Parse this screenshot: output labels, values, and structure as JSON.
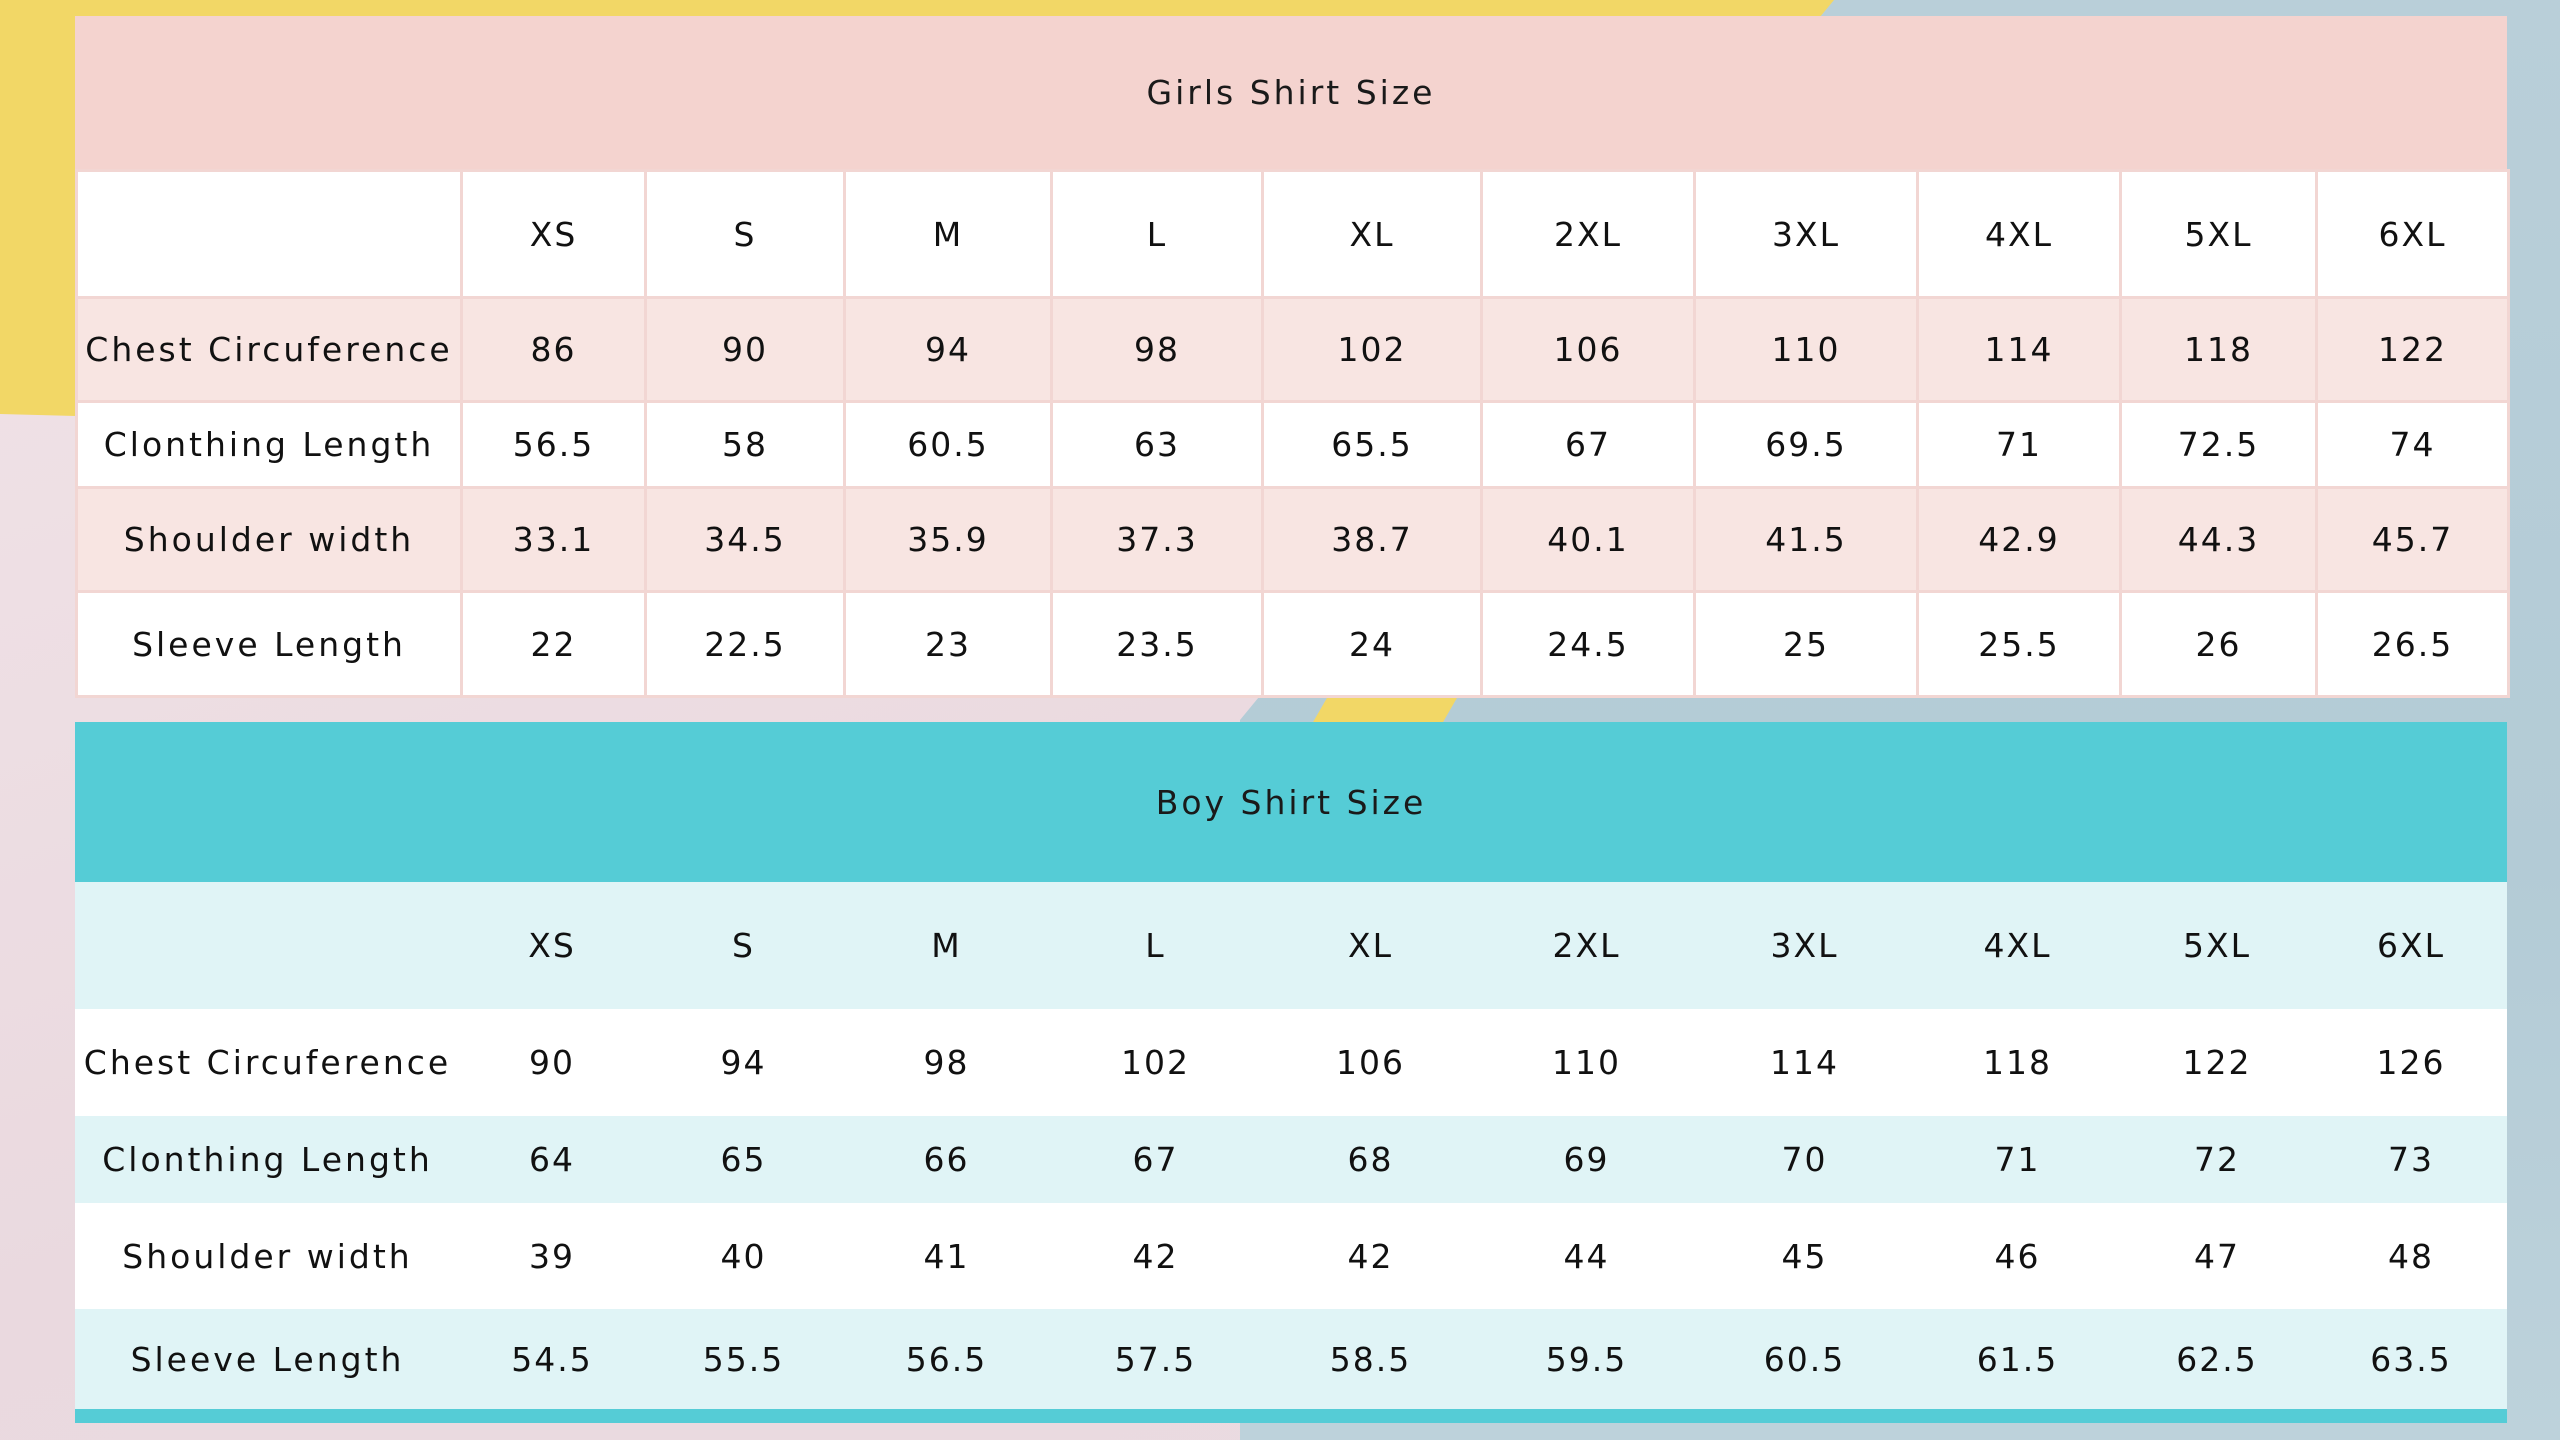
{
  "girls": {
    "title": "Girls Shirt Size",
    "sizes": [
      "XS",
      "S",
      "M",
      "L",
      "XL",
      "2XL",
      "3XL",
      "4XL",
      "5XL",
      "6XL"
    ],
    "rows": [
      {
        "label": "Chest Circuference",
        "values": [
          "86",
          "90",
          "94",
          "98",
          "102",
          "106",
          "110",
          "114",
          "118",
          "122"
        ]
      },
      {
        "label": "Clonthing Length",
        "values": [
          "56.5",
          "58",
          "60.5",
          "63",
          "65.5",
          "67",
          "69.5",
          "71",
          "72.5",
          "74"
        ]
      },
      {
        "label": "Shoulder width",
        "values": [
          "33.1",
          "34.5",
          "35.9",
          "37.3",
          "38.7",
          "40.1",
          "41.5",
          "42.9",
          "44.3",
          "45.7"
        ]
      },
      {
        "label": "Sleeve Length",
        "values": [
          "22",
          "22.5",
          "23",
          "23.5",
          "24",
          "24.5",
          "25",
          "25.5",
          "26",
          "26.5"
        ]
      }
    ]
  },
  "boys": {
    "title": "Boy Shirt Size",
    "sizes": [
      "XS",
      "S",
      "M",
      "L",
      "XL",
      "2XL",
      "3XL",
      "4XL",
      "5XL",
      "6XL"
    ],
    "rows": [
      {
        "label": "Chest Circuference",
        "values": [
          "90",
          "94",
          "98",
          "102",
          "106",
          "110",
          "114",
          "118",
          "122",
          "126"
        ]
      },
      {
        "label": "Clonthing Length",
        "values": [
          "64",
          "65",
          "66",
          "67",
          "68",
          "69",
          "70",
          "71",
          "72",
          "73"
        ]
      },
      {
        "label": "Shoulder width",
        "values": [
          "39",
          "40",
          "41",
          "42",
          "42",
          "44",
          "45",
          "46",
          "47",
          "48"
        ]
      },
      {
        "label": "Sleeve Length",
        "values": [
          "54.5",
          "55.5",
          "56.5",
          "57.5",
          "58.5",
          "59.5",
          "60.5",
          "61.5",
          "62.5",
          "63.5"
        ]
      }
    ]
  },
  "colors": {
    "girls_header": "#f4d3cf",
    "girls_band": "#f8e5e2",
    "boys_header": "#55ccd6",
    "boys_band": "#e0f4f6"
  }
}
